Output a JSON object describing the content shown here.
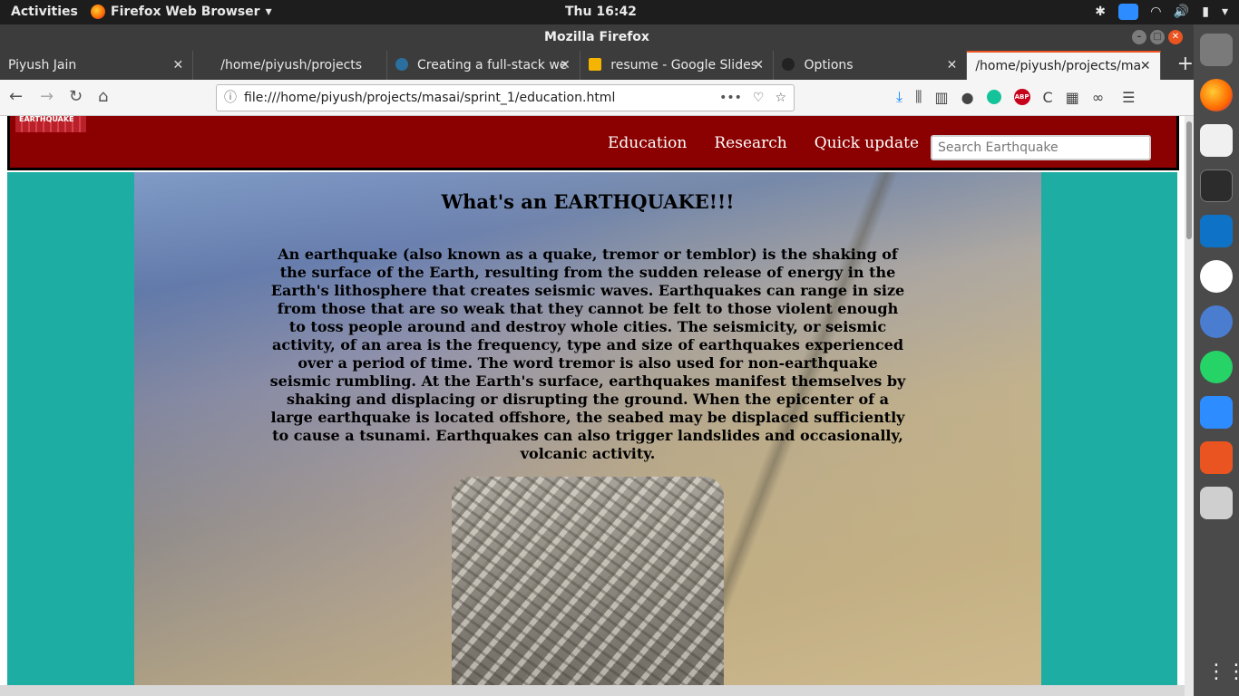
{
  "system_bar": {
    "activities": "Activities",
    "app_name": "Firefox Web Browser",
    "clock": "Thu 16:42"
  },
  "window": {
    "title": "Mozilla Firefox"
  },
  "tabs": [
    {
      "label": "Piyush Jain"
    },
    {
      "label": "/home/piyush/projects"
    },
    {
      "label": "Creating a full-stack we"
    },
    {
      "label": "resume - Google Slides"
    },
    {
      "label": "Options"
    },
    {
      "label": "/home/piyush/projects/ma"
    }
  ],
  "address_bar": {
    "url": "file:///home/piyush/projects/masai/sprint_1/education.html"
  },
  "site": {
    "logo_text": "EARTHQUAKE",
    "nav": [
      "Education",
      "Research",
      "Quick update"
    ],
    "search_placeholder": "Search Earthquake",
    "heading": "What's an EARTHQUAKE!!!",
    "paragraph": "An earthquake (also known as a quake, tremor or temblor) is the shaking of the surface of the Earth, resulting from the sudden release of energy in the Earth's lithosphere that creates seismic waves. Earthquakes can range in size from those that are so weak that they cannot be felt to those violent enough to toss people around and destroy whole cities. The seismicity, or seismic activity, of an area is the frequency, type and size of earthquakes experienced over a period of time. The word tremor is also used for non-earthquake seismic rumbling. At the Earth's surface, earthquakes manifest themselves by shaking and displacing or disrupting the ground. When the epicenter of a large earthquake is located offshore, the seabed may be displaced sufficiently to cause a tsunami. Earthquakes can also trigger landslides and occasionally, volcanic activity."
  },
  "colors": {
    "header_bg": "#8b0000",
    "page_bg": "#1eada3",
    "accent": "#e95420"
  }
}
